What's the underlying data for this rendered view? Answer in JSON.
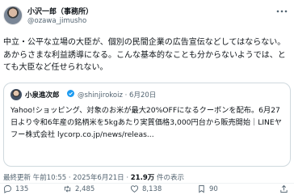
{
  "header": {
    "display_name": "小沢一郎（事務所）",
    "handle": "@ozawa_jimusho"
  },
  "post": {
    "text": "中立・公平な立場の大臣が、個別の民間企業の広告宣伝などしてはならない。あからさまな利益誘導になる。こんな基本的なことも分からないようでは、とても大臣など任せられない。"
  },
  "quote": {
    "name": "小泉進次郎",
    "handle_date": "@shinjirokoiz · 6月20日",
    "text": "Yahoo!ショッピング、対象のお米が最大20%OFFになるクーポンを配布。6月27日より令和6年産の銘柄米を5kgあたり実質価格3,000円台から販売開始｜LINEヤフー株式会社 ",
    "link": "lycorp.co.jp/news/releas..."
  },
  "meta": {
    "time_date": "最終更新 午前10:55 · 2025年6月21日 · ",
    "views_count": "21.9万",
    "views_label": " 件の表示"
  },
  "actions": {
    "replies": "135",
    "reposts": "2,485",
    "likes": "8,138",
    "bookmarks": "90"
  },
  "colors": {
    "text": "#0f1419",
    "muted": "#536471",
    "border": "#cfd9de",
    "verified": "#1d9bf0"
  }
}
